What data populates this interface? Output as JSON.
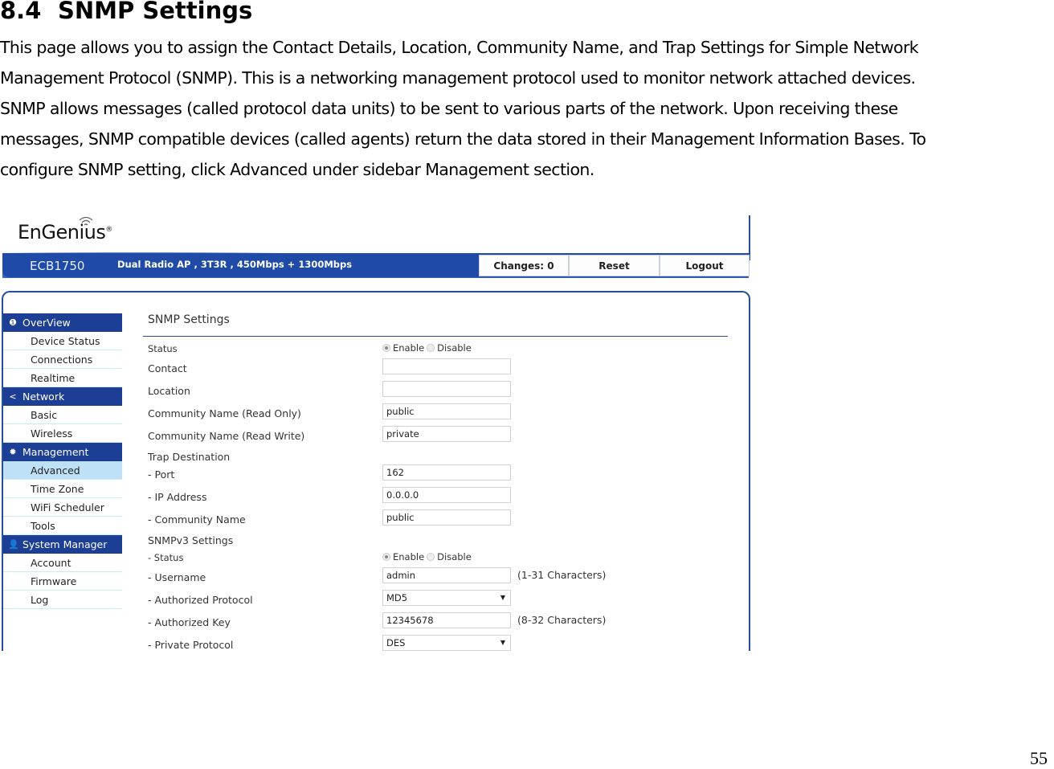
{
  "document": {
    "section_number": "8.4",
    "section_title": "SNMP Settings",
    "paragraph_lines": [
      "This page allows you to assign the Contact Details, Location, Community Name, and Trap Settings for Simple Network",
      "Management Protocol (SNMP). This is a networking management protocol used to monitor network attached devices.",
      "SNMP allows messages (called protocol data units) to be sent to various parts of the network. Upon receiving these",
      "messages, SNMP compatible devices (called agents) return the data stored in their Management Information Bases. To",
      "configure SNMP setting, click Advanced under sidebar Management section."
    ],
    "page_number": "55"
  },
  "header": {
    "logo": "EnGenius",
    "logo_mark": "®",
    "model": "ECB1750",
    "tagline": "Dual Radio AP , 3T3R , 450Mbps + 1300Mbps",
    "buttons": {
      "changes": "Changes: 0",
      "reset": "Reset",
      "logout": "Logout"
    },
    "bar_color": "#1f4aa8"
  },
  "sidebar": {
    "sections": [
      {
        "label": "OverView",
        "icon": "info-icon",
        "items": [
          "Device Status",
          "Connections",
          "Realtime"
        ]
      },
      {
        "label": "Network",
        "icon": "share-icon",
        "items": [
          "Basic",
          "Wireless"
        ]
      },
      {
        "label": "Management",
        "icon": "gear-icon",
        "items": [
          "Advanced",
          "Time Zone",
          "WiFi Scheduler",
          "Tools"
        ]
      },
      {
        "label": "System Manager",
        "icon": "user-icon",
        "items": [
          "Account",
          "Firmware",
          "Log"
        ]
      }
    ],
    "active_item": "Advanced"
  },
  "form": {
    "title": "SNMP Settings",
    "status": {
      "label": "Status",
      "enable": "Enable",
      "disable": "Disable",
      "selected": "Enable"
    },
    "contact": {
      "label": "Contact",
      "value": ""
    },
    "location": {
      "label": "Location",
      "value": ""
    },
    "community_ro": {
      "label": "Community Name (Read Only)",
      "value": "public"
    },
    "community_rw": {
      "label": "Community Name (Read Write)",
      "value": "private"
    },
    "trap_heading": "Trap Destination",
    "trap_port": {
      "label": "- Port",
      "value": "162"
    },
    "trap_ip": {
      "label": "- IP Address",
      "value": "0.0.0.0"
    },
    "trap_community": {
      "label": "- Community Name",
      "value": "public"
    },
    "v3_heading": "SNMPv3 Settings",
    "v3_status": {
      "label": "- Status",
      "enable": "Enable",
      "disable": "Disable",
      "selected": "Enable"
    },
    "v3_username": {
      "label": "- Username",
      "value": "admin",
      "hint": "(1-31 Characters)"
    },
    "v3_auth_protocol": {
      "label": "- Authorized Protocol",
      "value": "MD5"
    },
    "v3_auth_key": {
      "label": "- Authorized Key",
      "value": "12345678",
      "hint": "(8-32 Characters)"
    },
    "v3_priv_protocol": {
      "label": "- Private Protocol",
      "value": "DES"
    }
  }
}
